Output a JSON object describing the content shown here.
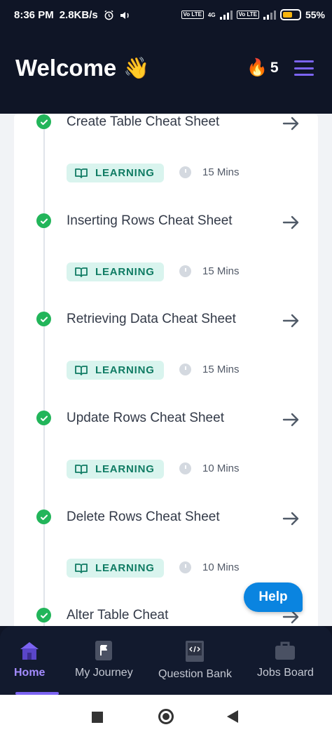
{
  "status_bar": {
    "time": "8:36 PM",
    "speed": "2.8KB/s",
    "network_1": "4G",
    "volte_1": "Vo LTE",
    "volte_2": "Vo LTE",
    "battery": "55%"
  },
  "header": {
    "title": "Welcome",
    "wave_emoji": "👋",
    "streak_icon": "🔥",
    "streak_count": "5"
  },
  "items": [
    {
      "title": "Create Table Cheat Sheet",
      "badge": "LEARNING",
      "duration": "15 Mins"
    },
    {
      "title": "Inserting Rows Cheat Sheet",
      "badge": "LEARNING",
      "duration": "15 Mins"
    },
    {
      "title": "Retrieving Data Cheat Sheet",
      "badge": "LEARNING",
      "duration": "15 Mins"
    },
    {
      "title": "Update Rows Cheat Sheet",
      "badge": "LEARNING",
      "duration": "10 Mins"
    },
    {
      "title": "Delete Rows Cheat Sheet",
      "badge": "LEARNING",
      "duration": "10 Mins"
    },
    {
      "title": "Alter Table Cheat",
      "badge": "",
      "duration": ""
    }
  ],
  "help": {
    "label": "Help"
  },
  "nav": {
    "home": "Home",
    "journey": "My Journey",
    "question_bank": "Question Bank",
    "jobs_board": "Jobs Board",
    "active": "Home"
  },
  "colors": {
    "header_bg": "#0f1526",
    "accent": "#7c64f2",
    "check_green": "#22b55a",
    "badge_bg": "#d9f4ee",
    "badge_text": "#0f7b63",
    "help_blue": "#0a84e0"
  }
}
